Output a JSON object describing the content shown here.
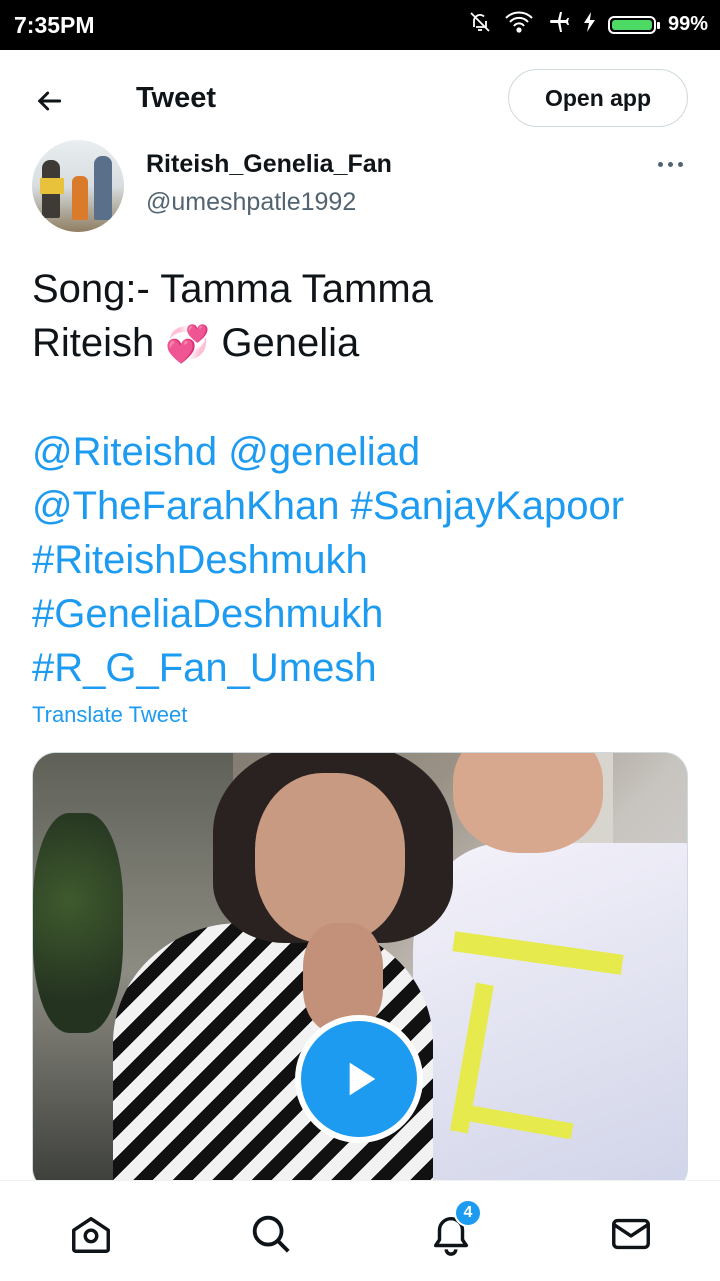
{
  "status_bar": {
    "time": "7:35PM",
    "battery_percent": "99%",
    "icons": [
      "notifications-off-icon",
      "wifi-icon",
      "airplane-icon",
      "charging-icon",
      "battery-icon"
    ]
  },
  "header": {
    "title": "Tweet",
    "open_app_label": "Open app"
  },
  "author": {
    "name": "Riteish_Genelia_Fan",
    "handle": "@umeshpatle1992"
  },
  "tweet": {
    "text_line1": "Song:- Tamma Tamma",
    "text_line2_a": "Riteish",
    "text_line2_emoji": "💞",
    "text_line2_b": "Genelia",
    "mentions": [
      "@Riteishd",
      "@geneliad",
      "@TheFarahKhan"
    ],
    "hashtags": [
      "#SanjayKapoor",
      "#RiteishDeshmukh",
      "#GeneliaDeshmukh",
      "#R_G_Fan_Umesh"
    ],
    "translate_label": "Translate Tweet"
  },
  "bottom_nav": {
    "notifications_badge": "4",
    "items": [
      "home-icon",
      "search-icon",
      "notifications-icon",
      "messages-icon"
    ]
  },
  "colors": {
    "accent": "#1d9bf0",
    "text": "#0f1419",
    "secondary_text": "#536471"
  }
}
